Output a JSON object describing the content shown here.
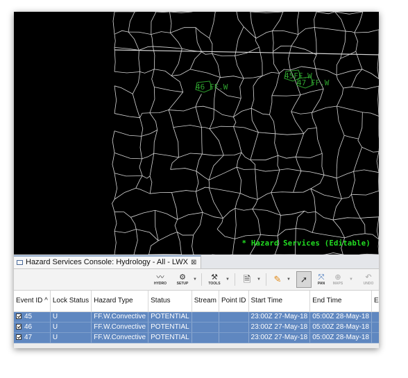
{
  "map": {
    "overlay_label": "* Hazard Services (Editable)",
    "hazard_labels": [
      {
        "text": "46 FF.W",
        "color": "#2ea02e"
      },
      {
        "text": "45FF.W",
        "color": "#2ea02e"
      },
      {
        "text": "47 FF.W",
        "color": "#2ea02e"
      }
    ]
  },
  "console": {
    "tab_title": "Hazard Services Console: Hydrology - All - LWX",
    "tab_close": "⊠",
    "toolbar": {
      "hydro": "HYDRO",
      "setup": "SETUP",
      "tools": "TOOLS",
      "pan": "PAN",
      "maps": "MAPS",
      "undo": "UNDO"
    },
    "columns": [
      "Event ID ^",
      "Lock Status",
      "Hazard Type",
      "Status",
      "Stream",
      "Point ID",
      "Start Time",
      "End Time",
      "Expiration"
    ],
    "rows": [
      {
        "event_id": "45",
        "lock": "U",
        "type": "FF.W.Convective",
        "status": "POTENTIAL",
        "stream": "",
        "point": "",
        "start": "23:00Z 27-May-18",
        "end": "05:00Z 28-May-18",
        "exp": ""
      },
      {
        "event_id": "46",
        "lock": "U",
        "type": "FF.W.Convective",
        "status": "POTENTIAL",
        "stream": "",
        "point": "",
        "start": "23:00Z 27-May-18",
        "end": "05:00Z 28-May-18",
        "exp": ""
      },
      {
        "event_id": "47",
        "lock": "U",
        "type": "FF.W.Convective",
        "status": "POTENTIAL",
        "stream": "",
        "point": "",
        "start": "23:00Z 27-May-18",
        "end": "05:00Z 28-May-18",
        "exp": ""
      }
    ]
  }
}
